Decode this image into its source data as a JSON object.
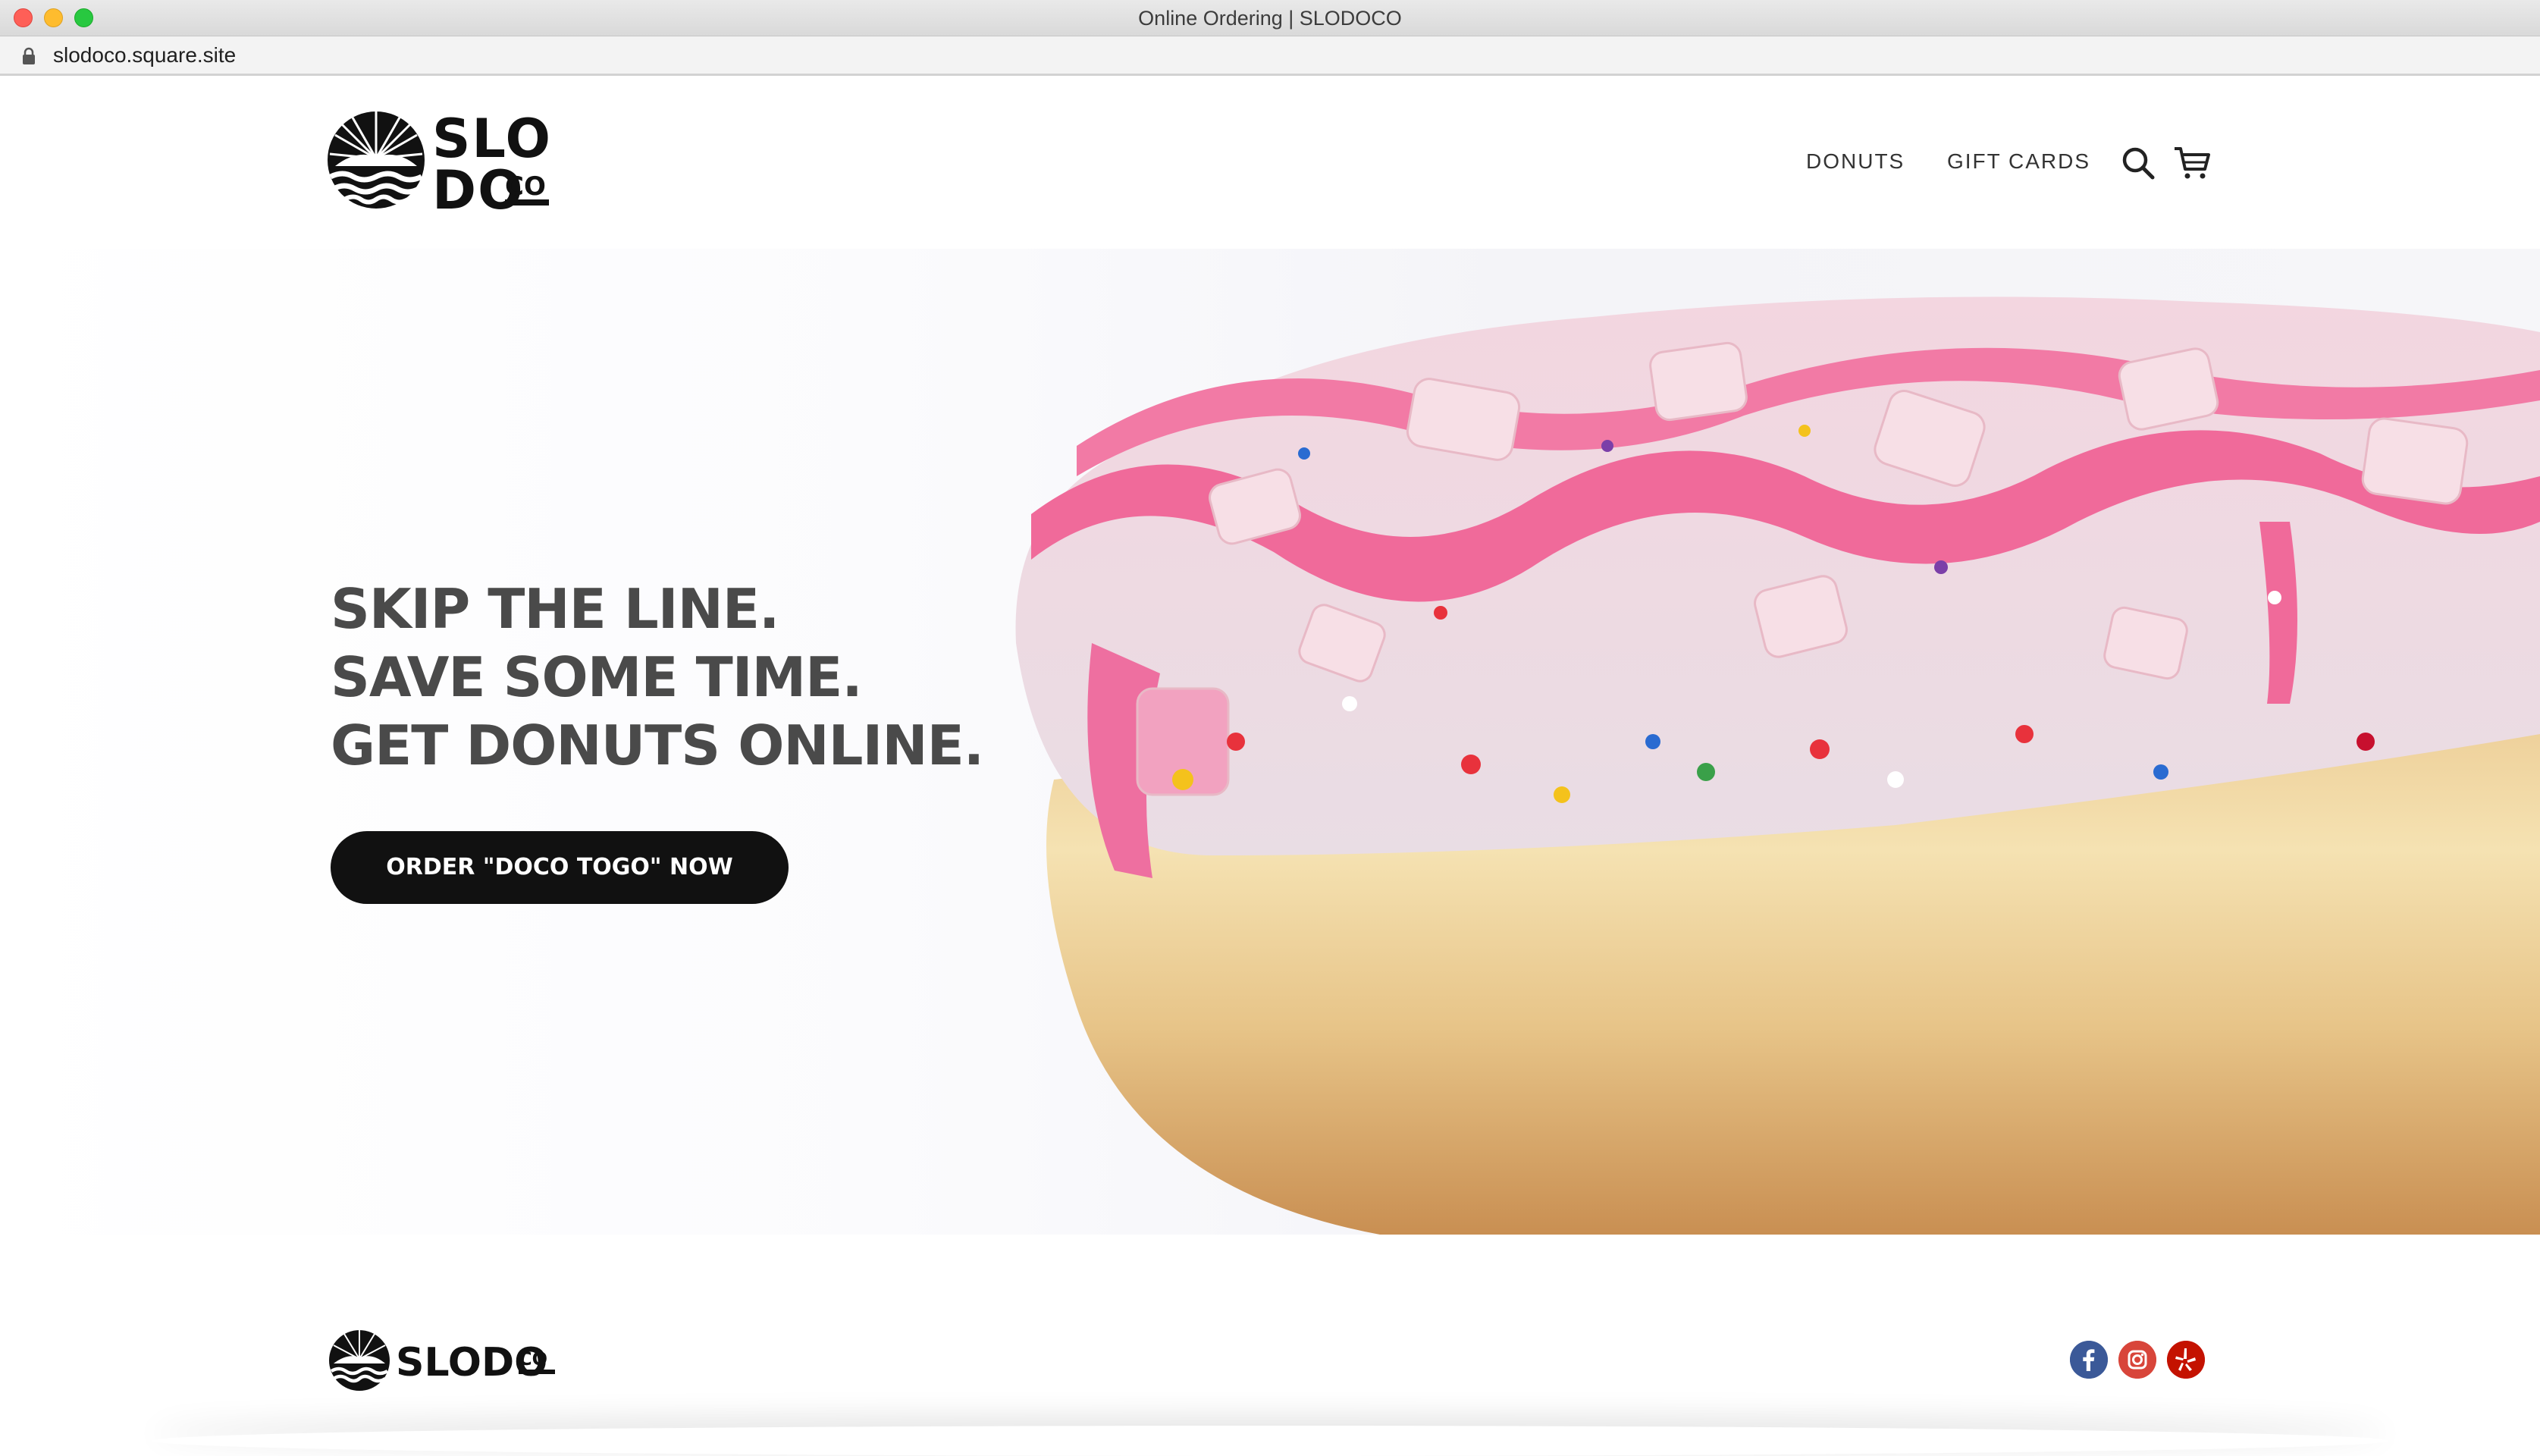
{
  "window": {
    "title": "Online Ordering | SLODOCO"
  },
  "browser": {
    "url": "slodoco.square.site"
  },
  "header": {
    "logo_text_line1": "SLO",
    "logo_text_line2": "DO",
    "logo_text_co": "CO",
    "nav": [
      {
        "label": "DONUTS"
      },
      {
        "label": "GIFT CARDS"
      }
    ],
    "icons": [
      "search-icon",
      "cart-icon"
    ]
  },
  "hero": {
    "lines": [
      "SKIP THE LINE.",
      "SAVE SOME TIME.",
      "GET DONUTS ONLINE."
    ],
    "cta_label": "ORDER \"DOCO TOGO\" NOW"
  },
  "footer": {
    "logo_text": "SLODO",
    "logo_text_co": "CO",
    "social": [
      "facebook-icon",
      "instagram-icon",
      "yelp-icon"
    ]
  },
  "colors": {
    "text_dark": "#4a4a4a",
    "button": "#111111",
    "frosting_pink": "#f06a9a",
    "facebook": "#3b5998",
    "instagram": "#d8453a",
    "yelp": "#c41200"
  }
}
